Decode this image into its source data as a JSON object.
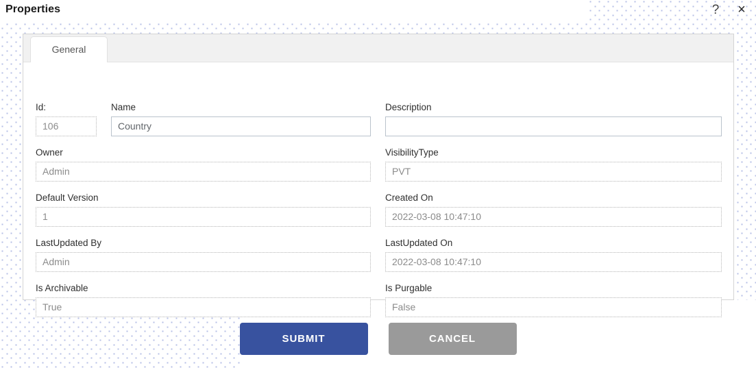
{
  "window": {
    "title": "Properties",
    "help_icon": "?",
    "close_icon": "×"
  },
  "tabs": [
    {
      "label": "General",
      "active": true
    }
  ],
  "form": {
    "fields": [
      {
        "label": "Id:",
        "value": "106",
        "editable": false
      },
      {
        "label": "Name",
        "value": "Country",
        "editable": true
      },
      {
        "label": "Description",
        "value": "",
        "editable": true
      },
      {
        "label": "Owner",
        "value": "Admin",
        "editable": false
      },
      {
        "label": "VisibilityType",
        "value": "PVT",
        "editable": false
      },
      {
        "label": "Default Version",
        "value": "1",
        "editable": false
      },
      {
        "label": "Created On",
        "value": "2022-03-08 10:47:10",
        "editable": false
      },
      {
        "label": "LastUpdated By",
        "value": "Admin",
        "editable": false
      },
      {
        "label": "LastUpdated On",
        "value": "2022-03-08 10:47:10",
        "editable": false
      },
      {
        "label": "Is Archivable",
        "value": "True",
        "editable": false
      },
      {
        "label": "Is Purgable",
        "value": "False",
        "editable": false
      }
    ]
  },
  "footer": {
    "submit_label": "SUBMIT",
    "cancel_label": "CANCEL"
  },
  "colors": {
    "submit_background": "#38529f",
    "cancel_background": "#9a9a9a",
    "panel_border": "#d4d4d4",
    "tabstrip_background": "#f1f1f1",
    "dot_pattern": "#b6bfe6"
  }
}
